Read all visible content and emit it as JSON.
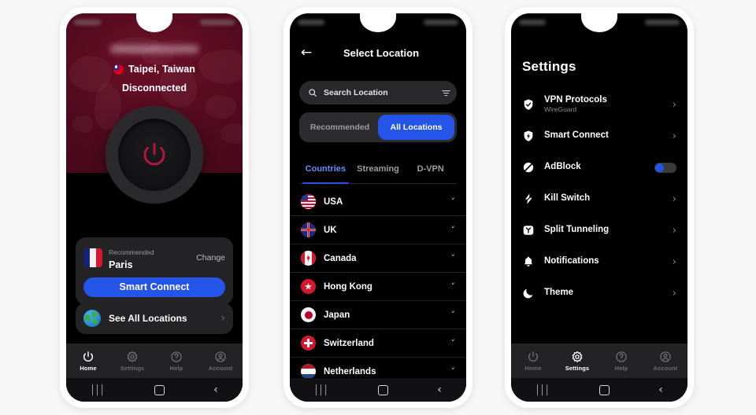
{
  "app": {
    "accent_blue": "#2554e8",
    "map_red": "#4e0a1d",
    "screen_black": "#000000"
  },
  "android_nav": {
    "recent_icon": "recent-apps-icon",
    "home_icon": "home-square-icon",
    "back_icon": "back-chevron-icon",
    "back_glyph": "‹",
    "recent_glyph": "|||"
  },
  "tabbar": {
    "items": [
      {
        "label": "Home",
        "icon": "power-icon"
      },
      {
        "label": "Settings",
        "icon": "gear-icon"
      },
      {
        "label": "Help",
        "icon": "question-circle-icon"
      },
      {
        "label": "Account",
        "icon": "user-circle-icon"
      }
    ]
  },
  "phone1": {
    "screen_name": "home-screen",
    "active_tab": "Home",
    "location": {
      "name": "Taipei, Taiwan",
      "flag": "taiwan-flag-icon"
    },
    "connection_status": "Disconnected",
    "power_button": {
      "icon": "power-icon",
      "color": "#b3163a"
    },
    "recommend_card": {
      "flag": "france-flag-icon",
      "label": "Recommended",
      "city": "Paris",
      "change_label": "Change",
      "smart_connect_label": "Smart Connect"
    },
    "all_locations": {
      "icon": "globe-icon",
      "label": "See All Locations",
      "chevron": "›"
    }
  },
  "phone2": {
    "screen_name": "select-location-screen",
    "back_icon": "back-arrow-icon",
    "title": "Select Location",
    "search": {
      "icon": "search-icon",
      "placeholder": "Search Location",
      "value": "",
      "filter_icon": "filter-icon"
    },
    "segments": [
      {
        "label": "Recommended",
        "selected": false
      },
      {
        "label": "All Locations",
        "selected": true
      }
    ],
    "subtabs": [
      {
        "label": "Countries",
        "selected": true
      },
      {
        "label": "Streaming",
        "selected": false
      },
      {
        "label": "D-VPN",
        "selected": false
      }
    ],
    "countries": [
      {
        "name": "USA",
        "flag": "usa-flag-icon",
        "chevron": "˅"
      },
      {
        "name": "UK",
        "flag": "uk-flag-icon",
        "chevron": "˅"
      },
      {
        "name": "Canada",
        "flag": "canada-flag-icon",
        "chevron": "˅"
      },
      {
        "name": "Hong Kong",
        "flag": "hongkong-flag-icon",
        "chevron": "˅"
      },
      {
        "name": "Japan",
        "flag": "japan-flag-icon",
        "chevron": "˅"
      },
      {
        "name": "Switzerland",
        "flag": "switzerland-flag-icon",
        "chevron": "˅"
      },
      {
        "name": "Netherlands",
        "flag": "netherlands-flag-icon",
        "chevron": "˅"
      }
    ]
  },
  "phone3": {
    "screen_name": "settings-screen",
    "active_tab": "Settings",
    "title": "Settings",
    "items": [
      {
        "label": "VPN Protocols",
        "sublabel": "WireGuard",
        "icon": "shield-check-icon",
        "control": "chevron",
        "chevron": "›"
      },
      {
        "label": "Smart Connect",
        "sublabel": "",
        "icon": "shield-bolt-icon",
        "control": "chevron",
        "chevron": "›"
      },
      {
        "label": "AdBlock",
        "sublabel": "",
        "icon": "adblock-icon",
        "control": "toggle",
        "toggle_on": true
      },
      {
        "label": "Kill Switch",
        "sublabel": "",
        "icon": "lightning-icon",
        "control": "chevron",
        "chevron": "›"
      },
      {
        "label": "Split Tunneling",
        "sublabel": "",
        "icon": "split-tunnel-icon",
        "control": "chevron",
        "chevron": "›"
      },
      {
        "label": "Notifications",
        "sublabel": "",
        "icon": "bell-icon",
        "control": "chevron",
        "chevron": "›"
      },
      {
        "label": "Theme",
        "sublabel": "",
        "icon": "moon-icon",
        "control": "chevron",
        "chevron": "›"
      }
    ]
  }
}
